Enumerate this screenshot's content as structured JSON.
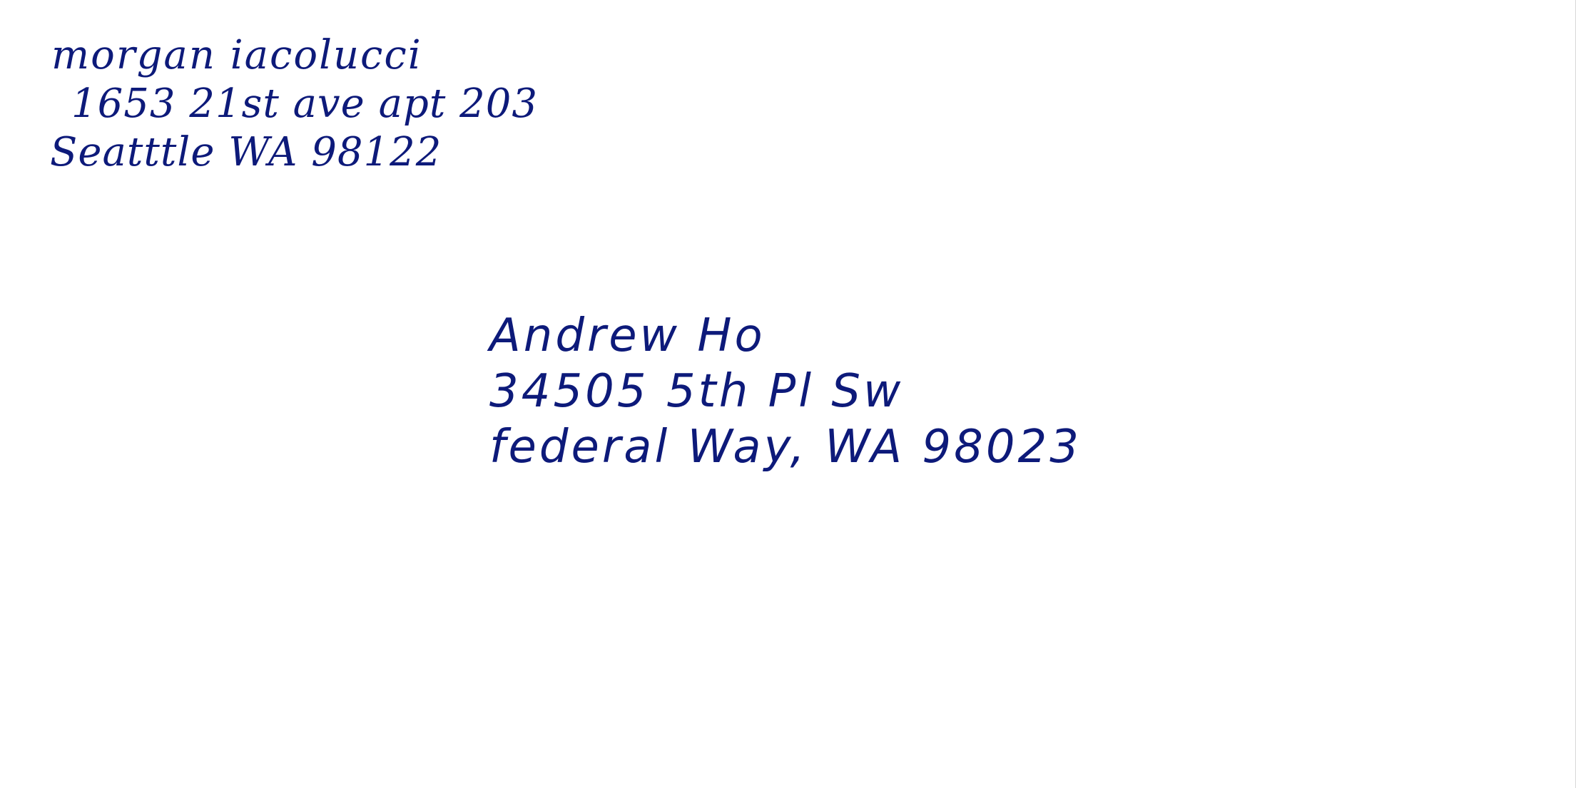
{
  "envelope": {
    "ink_color": "#0d1a7a",
    "background": "#ffffff",
    "return_address": {
      "name": "morgan iacolucci",
      "street": "1653 21st ave apt 203",
      "city_line": "Seatttle WA 98122"
    },
    "recipient_address": {
      "name": "Andrew Ho",
      "street": "34505 5th Pl Sw",
      "city_line": "federal Way, WA 98023"
    }
  }
}
